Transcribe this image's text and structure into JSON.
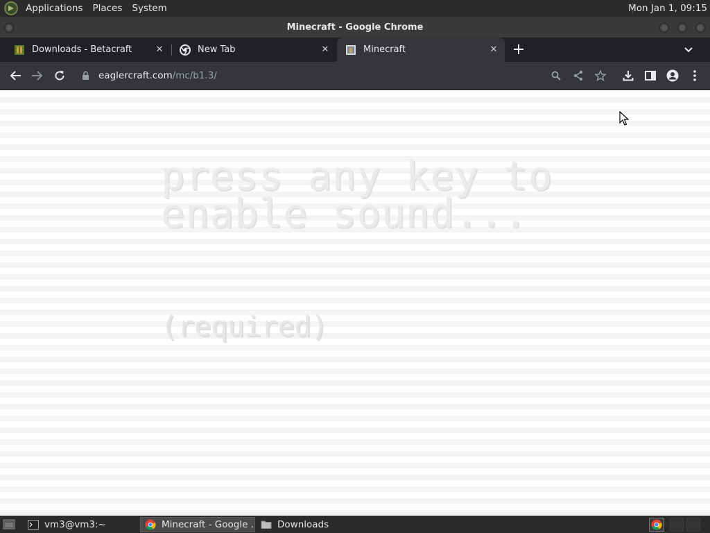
{
  "top_panel": {
    "menus": [
      "Applications",
      "Places",
      "System"
    ],
    "clock": "Mon Jan 1, 09:15"
  },
  "window": {
    "title": "Minecraft - Google Chrome"
  },
  "tabs": [
    {
      "title": "Downloads - Betacraft",
      "favicon": "betacraft-icon",
      "active": false
    },
    {
      "title": "New Tab",
      "favicon": "chrome-icon",
      "active": false
    },
    {
      "title": "Minecraft",
      "favicon": "minecraft-icon",
      "active": true
    }
  ],
  "toolbar": {
    "url_host": "eaglercraft.com",
    "url_path": "/mc/b1.3/"
  },
  "page": {
    "prompt_line1": "press any key to",
    "prompt_line2": "enable sound...",
    "required": "(required)"
  },
  "taskbar": {
    "items": [
      {
        "label": "vm3@vm3:~",
        "icon": "terminal-icon",
        "active": false
      },
      {
        "label": "Minecraft - Google ...",
        "icon": "chrome-icon",
        "active": true
      },
      {
        "label": "Downloads",
        "icon": "folder-icon",
        "active": false
      }
    ]
  },
  "colors": {
    "panel_bg": "#2b2b2b",
    "tabstrip_bg": "#202124",
    "toolbar_bg": "#35363a",
    "page_stripe": "#f4f4f4",
    "page_text": "#ebebeb"
  }
}
